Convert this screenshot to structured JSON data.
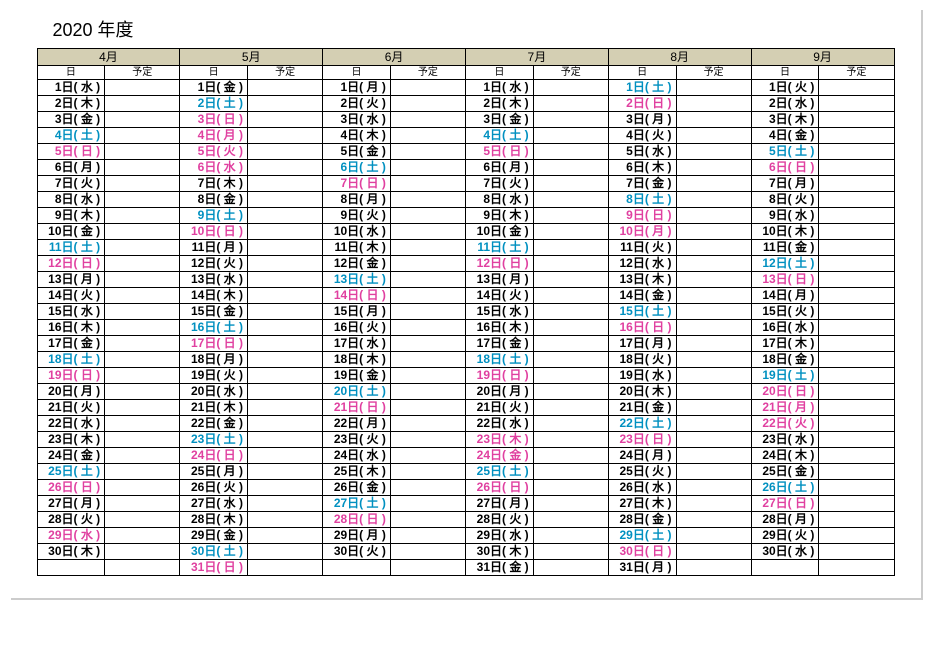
{
  "title": "2020 年度",
  "subheaders": {
    "day": "日",
    "plan": "予定"
  },
  "months": [
    {
      "name": "4月",
      "days": [
        {
          "t": "1日( 水 )",
          "c": "black"
        },
        {
          "t": "2日( 木 )",
          "c": "black"
        },
        {
          "t": "3日( 金 )",
          "c": "black"
        },
        {
          "t": "4日( 土 )",
          "c": "blue"
        },
        {
          "t": "5日( 日 )",
          "c": "pink"
        },
        {
          "t": "6日( 月 )",
          "c": "black"
        },
        {
          "t": "7日( 火 )",
          "c": "black"
        },
        {
          "t": "8日( 水 )",
          "c": "black"
        },
        {
          "t": "9日( 木 )",
          "c": "black"
        },
        {
          "t": "10日( 金 )",
          "c": "black"
        },
        {
          "t": "11日( 土 )",
          "c": "blue"
        },
        {
          "t": "12日( 日 )",
          "c": "pink"
        },
        {
          "t": "13日( 月 )",
          "c": "black"
        },
        {
          "t": "14日( 火 )",
          "c": "black"
        },
        {
          "t": "15日( 水 )",
          "c": "black"
        },
        {
          "t": "16日( 木 )",
          "c": "black"
        },
        {
          "t": "17日( 金 )",
          "c": "black"
        },
        {
          "t": "18日( 土 )",
          "c": "blue"
        },
        {
          "t": "19日( 日 )",
          "c": "pink"
        },
        {
          "t": "20日( 月 )",
          "c": "black"
        },
        {
          "t": "21日( 火 )",
          "c": "black"
        },
        {
          "t": "22日( 水 )",
          "c": "black"
        },
        {
          "t": "23日( 木 )",
          "c": "black"
        },
        {
          "t": "24日( 金 )",
          "c": "black"
        },
        {
          "t": "25日( 土 )",
          "c": "blue"
        },
        {
          "t": "26日( 日 )",
          "c": "pink"
        },
        {
          "t": "27日( 月 )",
          "c": "black"
        },
        {
          "t": "28日( 火 )",
          "c": "black"
        },
        {
          "t": "29日( 水 )",
          "c": "pink"
        },
        {
          "t": "30日( 木 )",
          "c": "black"
        },
        {
          "t": "",
          "c": "black"
        }
      ]
    },
    {
      "name": "5月",
      "days": [
        {
          "t": "1日( 金 )",
          "c": "black"
        },
        {
          "t": "2日( 土 )",
          "c": "blue"
        },
        {
          "t": "3日( 日 )",
          "c": "pink"
        },
        {
          "t": "4日( 月 )",
          "c": "pink"
        },
        {
          "t": "5日( 火 )",
          "c": "pink"
        },
        {
          "t": "6日( 水 )",
          "c": "pink"
        },
        {
          "t": "7日( 木 )",
          "c": "black"
        },
        {
          "t": "8日( 金 )",
          "c": "black"
        },
        {
          "t": "9日( 土 )",
          "c": "blue"
        },
        {
          "t": "10日( 日 )",
          "c": "pink"
        },
        {
          "t": "11日( 月 )",
          "c": "black"
        },
        {
          "t": "12日( 火 )",
          "c": "black"
        },
        {
          "t": "13日( 水 )",
          "c": "black"
        },
        {
          "t": "14日( 木 )",
          "c": "black"
        },
        {
          "t": "15日( 金 )",
          "c": "black"
        },
        {
          "t": "16日( 土 )",
          "c": "blue"
        },
        {
          "t": "17日( 日 )",
          "c": "pink"
        },
        {
          "t": "18日( 月 )",
          "c": "black"
        },
        {
          "t": "19日( 火 )",
          "c": "black"
        },
        {
          "t": "20日( 水 )",
          "c": "black"
        },
        {
          "t": "21日( 木 )",
          "c": "black"
        },
        {
          "t": "22日( 金 )",
          "c": "black"
        },
        {
          "t": "23日( 土 )",
          "c": "blue"
        },
        {
          "t": "24日( 日 )",
          "c": "pink"
        },
        {
          "t": "25日( 月 )",
          "c": "black"
        },
        {
          "t": "26日( 火 )",
          "c": "black"
        },
        {
          "t": "27日( 水 )",
          "c": "black"
        },
        {
          "t": "28日( 木 )",
          "c": "black"
        },
        {
          "t": "29日( 金 )",
          "c": "black"
        },
        {
          "t": "30日( 土 )",
          "c": "blue"
        },
        {
          "t": "31日( 日 )",
          "c": "pink"
        }
      ]
    },
    {
      "name": "6月",
      "days": [
        {
          "t": "1日( 月 )",
          "c": "black"
        },
        {
          "t": "2日( 火 )",
          "c": "black"
        },
        {
          "t": "3日( 水 )",
          "c": "black"
        },
        {
          "t": "4日( 木 )",
          "c": "black"
        },
        {
          "t": "5日( 金 )",
          "c": "black"
        },
        {
          "t": "6日( 土 )",
          "c": "blue"
        },
        {
          "t": "7日( 日 )",
          "c": "pink"
        },
        {
          "t": "8日( 月 )",
          "c": "black"
        },
        {
          "t": "9日( 火 )",
          "c": "black"
        },
        {
          "t": "10日( 水 )",
          "c": "black"
        },
        {
          "t": "11日( 木 )",
          "c": "black"
        },
        {
          "t": "12日( 金 )",
          "c": "black"
        },
        {
          "t": "13日( 土 )",
          "c": "blue"
        },
        {
          "t": "14日( 日 )",
          "c": "pink"
        },
        {
          "t": "15日( 月 )",
          "c": "black"
        },
        {
          "t": "16日( 火 )",
          "c": "black"
        },
        {
          "t": "17日( 水 )",
          "c": "black"
        },
        {
          "t": "18日( 木 )",
          "c": "black"
        },
        {
          "t": "19日( 金 )",
          "c": "black"
        },
        {
          "t": "20日( 土 )",
          "c": "blue"
        },
        {
          "t": "21日( 日 )",
          "c": "pink"
        },
        {
          "t": "22日( 月 )",
          "c": "black"
        },
        {
          "t": "23日( 火 )",
          "c": "black"
        },
        {
          "t": "24日( 水 )",
          "c": "black"
        },
        {
          "t": "25日( 木 )",
          "c": "black"
        },
        {
          "t": "26日( 金 )",
          "c": "black"
        },
        {
          "t": "27日( 土 )",
          "c": "blue"
        },
        {
          "t": "28日( 日 )",
          "c": "pink"
        },
        {
          "t": "29日( 月 )",
          "c": "black"
        },
        {
          "t": "30日( 火 )",
          "c": "black"
        },
        {
          "t": "",
          "c": "black"
        }
      ]
    },
    {
      "name": "7月",
      "days": [
        {
          "t": "1日( 水 )",
          "c": "black"
        },
        {
          "t": "2日( 木 )",
          "c": "black"
        },
        {
          "t": "3日( 金 )",
          "c": "black"
        },
        {
          "t": "4日( 土 )",
          "c": "blue"
        },
        {
          "t": "5日( 日 )",
          "c": "pink"
        },
        {
          "t": "6日( 月 )",
          "c": "black"
        },
        {
          "t": "7日( 火 )",
          "c": "black"
        },
        {
          "t": "8日( 水 )",
          "c": "black"
        },
        {
          "t": "9日( 木 )",
          "c": "black"
        },
        {
          "t": "10日( 金 )",
          "c": "black"
        },
        {
          "t": "11日( 土 )",
          "c": "blue"
        },
        {
          "t": "12日( 日 )",
          "c": "pink"
        },
        {
          "t": "13日( 月 )",
          "c": "black"
        },
        {
          "t": "14日( 火 )",
          "c": "black"
        },
        {
          "t": "15日( 水 )",
          "c": "black"
        },
        {
          "t": "16日( 木 )",
          "c": "black"
        },
        {
          "t": "17日( 金 )",
          "c": "black"
        },
        {
          "t": "18日( 土 )",
          "c": "blue"
        },
        {
          "t": "19日( 日 )",
          "c": "pink"
        },
        {
          "t": "20日( 月 )",
          "c": "black"
        },
        {
          "t": "21日( 火 )",
          "c": "black"
        },
        {
          "t": "22日( 水 )",
          "c": "black"
        },
        {
          "t": "23日( 木 )",
          "c": "pink"
        },
        {
          "t": "24日( 金 )",
          "c": "pink"
        },
        {
          "t": "25日( 土 )",
          "c": "blue"
        },
        {
          "t": "26日( 日 )",
          "c": "pink"
        },
        {
          "t": "27日( 月 )",
          "c": "black"
        },
        {
          "t": "28日( 火 )",
          "c": "black"
        },
        {
          "t": "29日( 水 )",
          "c": "black"
        },
        {
          "t": "30日( 木 )",
          "c": "black"
        },
        {
          "t": "31日( 金 )",
          "c": "black"
        }
      ]
    },
    {
      "name": "8月",
      "days": [
        {
          "t": "1日( 土 )",
          "c": "blue"
        },
        {
          "t": "2日( 日 )",
          "c": "pink"
        },
        {
          "t": "3日( 月 )",
          "c": "black"
        },
        {
          "t": "4日( 火 )",
          "c": "black"
        },
        {
          "t": "5日( 水 )",
          "c": "black"
        },
        {
          "t": "6日( 木 )",
          "c": "black"
        },
        {
          "t": "7日( 金 )",
          "c": "black"
        },
        {
          "t": "8日( 土 )",
          "c": "blue"
        },
        {
          "t": "9日( 日 )",
          "c": "pink"
        },
        {
          "t": "10日( 月 )",
          "c": "pink"
        },
        {
          "t": "11日( 火 )",
          "c": "black"
        },
        {
          "t": "12日( 水 )",
          "c": "black"
        },
        {
          "t": "13日( 木 )",
          "c": "black"
        },
        {
          "t": "14日( 金 )",
          "c": "black"
        },
        {
          "t": "15日( 土 )",
          "c": "blue"
        },
        {
          "t": "16日( 日 )",
          "c": "pink"
        },
        {
          "t": "17日( 月 )",
          "c": "black"
        },
        {
          "t": "18日( 火 )",
          "c": "black"
        },
        {
          "t": "19日( 水 )",
          "c": "black"
        },
        {
          "t": "20日( 木 )",
          "c": "black"
        },
        {
          "t": "21日( 金 )",
          "c": "black"
        },
        {
          "t": "22日( 土 )",
          "c": "blue"
        },
        {
          "t": "23日( 日 )",
          "c": "pink"
        },
        {
          "t": "24日( 月 )",
          "c": "black"
        },
        {
          "t": "25日( 火 )",
          "c": "black"
        },
        {
          "t": "26日( 水 )",
          "c": "black"
        },
        {
          "t": "27日( 木 )",
          "c": "black"
        },
        {
          "t": "28日( 金 )",
          "c": "black"
        },
        {
          "t": "29日( 土 )",
          "c": "blue"
        },
        {
          "t": "30日( 日 )",
          "c": "pink"
        },
        {
          "t": "31日( 月 )",
          "c": "black"
        }
      ]
    },
    {
      "name": "9月",
      "days": [
        {
          "t": "1日( 火 )",
          "c": "black"
        },
        {
          "t": "2日( 水 )",
          "c": "black"
        },
        {
          "t": "3日( 木 )",
          "c": "black"
        },
        {
          "t": "4日( 金 )",
          "c": "black"
        },
        {
          "t": "5日( 土 )",
          "c": "blue"
        },
        {
          "t": "6日( 日 )",
          "c": "pink"
        },
        {
          "t": "7日( 月 )",
          "c": "black"
        },
        {
          "t": "8日( 火 )",
          "c": "black"
        },
        {
          "t": "9日( 水 )",
          "c": "black"
        },
        {
          "t": "10日( 木 )",
          "c": "black"
        },
        {
          "t": "11日( 金 )",
          "c": "black"
        },
        {
          "t": "12日( 土 )",
          "c": "blue"
        },
        {
          "t": "13日( 日 )",
          "c": "pink"
        },
        {
          "t": "14日( 月 )",
          "c": "black"
        },
        {
          "t": "15日( 火 )",
          "c": "black"
        },
        {
          "t": "16日( 水 )",
          "c": "black"
        },
        {
          "t": "17日( 木 )",
          "c": "black"
        },
        {
          "t": "18日( 金 )",
          "c": "black"
        },
        {
          "t": "19日( 土 )",
          "c": "blue"
        },
        {
          "t": "20日( 日 )",
          "c": "pink"
        },
        {
          "t": "21日( 月 )",
          "c": "pink"
        },
        {
          "t": "22日( 火 )",
          "c": "pink"
        },
        {
          "t": "23日( 水 )",
          "c": "black"
        },
        {
          "t": "24日( 木 )",
          "c": "black"
        },
        {
          "t": "25日( 金 )",
          "c": "black"
        },
        {
          "t": "26日( 土 )",
          "c": "blue"
        },
        {
          "t": "27日( 日 )",
          "c": "pink"
        },
        {
          "t": "28日( 月 )",
          "c": "black"
        },
        {
          "t": "29日( 火 )",
          "c": "black"
        },
        {
          "t": "30日( 水 )",
          "c": "black"
        },
        {
          "t": "",
          "c": "black"
        }
      ]
    }
  ]
}
